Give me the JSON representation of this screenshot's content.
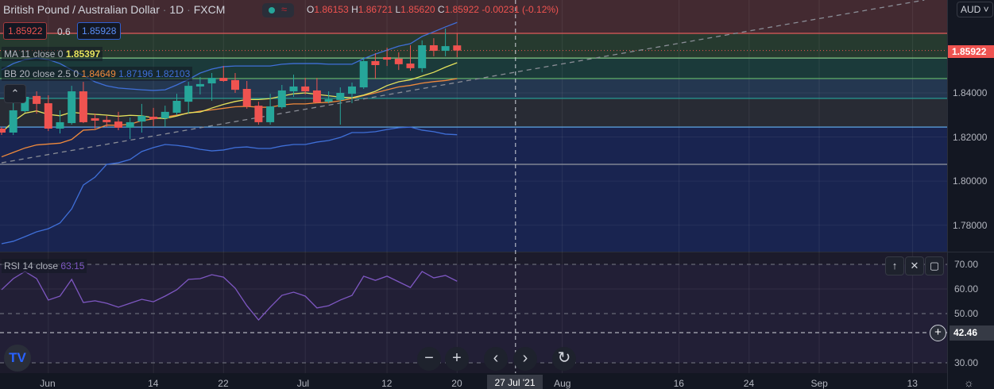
{
  "header": {
    "symbol": "British Pound / Australian Dollar",
    "interval": "1D",
    "source": "FXCM",
    "open_label": "O",
    "open": "1.86153",
    "high_label": "H",
    "high": "1.86721",
    "low_label": "L",
    "low": "1.85620",
    "close_label": "C",
    "close": "1.85922",
    "change": "-0.00231 (-0.12%)",
    "toggle_icon": "≈"
  },
  "trade": {
    "sell": "1.85922",
    "spread": "0.6",
    "buy": "1.85928"
  },
  "indicators": {
    "ma": {
      "label": "MA 11 close 0",
      "value": "1.85397"
    },
    "bb": {
      "label": "BB 20 close 2.5 0",
      "basis": "1.84649",
      "upper": "1.87196",
      "lower": "1.82103"
    },
    "rsi": {
      "label": "RSI 14 close",
      "value": "63.15"
    }
  },
  "currency": "AUD",
  "price_axis": {
    "ticks": [
      "1.84000",
      "1.82000",
      "1.80000",
      "1.78000"
    ],
    "last_price": "1.85922"
  },
  "rsi_axis": {
    "ticks": [
      "70.00",
      "60.00",
      "50.00",
      "30.00"
    ],
    "crosshair_value": "42.46"
  },
  "time_axis": {
    "labels": [
      "Jun",
      "14",
      "22",
      "Jul",
      "12",
      "20",
      "Aug",
      "16",
      "24",
      "Sep",
      "13"
    ],
    "crosshair_label": "27 Jul '21"
  },
  "colors": {
    "up": "#26a69a",
    "down": "#ef5350",
    "ma": "#e6e35c",
    "bb_basis": "#f08a3c",
    "bb_band": "#3f6fd8",
    "rsi": "#7e57c2"
  },
  "chart_data": {
    "type": "candlestick",
    "open": [
      1.8238,
      1.822,
      1.8317,
      1.8386,
      1.8353,
      1.8238,
      1.8263,
      1.8407,
      1.8285,
      1.8278,
      1.827,
      1.8242,
      1.827,
      1.8292,
      1.8285,
      1.831,
      1.836,
      1.8429,
      1.8443,
      1.8468,
      1.8458,
      1.8418,
      1.8342,
      1.8267,
      1.8335,
      1.8407,
      1.8429,
      1.8411,
      1.836,
      1.8368,
      1.8396,
      1.8425,
      1.8544,
      1.8562,
      1.8555,
      1.8533,
      1.8512,
      1.8616,
      1.8591,
      1.86153
    ],
    "high": [
      1.8245,
      1.836,
      1.8407,
      1.8407,
      1.8389,
      1.8321,
      1.8432,
      1.845,
      1.8306,
      1.8296,
      1.8314,
      1.8288,
      1.835,
      1.8332,
      1.8342,
      1.8396,
      1.845,
      1.8472,
      1.849,
      1.8522,
      1.849,
      1.8454,
      1.836,
      1.8396,
      1.8436,
      1.8483,
      1.8468,
      1.8468,
      1.8407,
      1.8425,
      1.8447,
      1.8562,
      1.858,
      1.8605,
      1.8584,
      1.8616,
      1.8638,
      1.8648,
      1.8692,
      1.86721
    ],
    "low": [
      1.8209,
      1.8209,
      1.831,
      1.8306,
      1.8227,
      1.8216,
      1.8256,
      1.8263,
      1.8238,
      1.8245,
      1.8231,
      1.8191,
      1.822,
      1.8249,
      1.8245,
      1.8299,
      1.8306,
      1.8393,
      1.8364,
      1.845,
      1.84,
      1.8328,
      1.8256,
      1.8256,
      1.8328,
      1.8382,
      1.8393,
      1.8353,
      1.8353,
      1.8256,
      1.8353,
      1.8418,
      1.8465,
      1.8522,
      1.8504,
      1.8501,
      1.8494,
      1.8566,
      1.8566,
      1.8562
    ],
    "close": [
      1.822,
      1.8321,
      1.8382,
      1.835,
      1.8238,
      1.8267,
      1.8407,
      1.8267,
      1.8274,
      1.8267,
      1.8242,
      1.8267,
      1.8296,
      1.8281,
      1.8314,
      1.8364,
      1.8432,
      1.844,
      1.8468,
      1.8454,
      1.8414,
      1.8339,
      1.8267,
      1.8339,
      1.8411,
      1.8429,
      1.8407,
      1.8357,
      1.8371,
      1.84,
      1.8429,
      1.8544,
      1.8526,
      1.8551,
      1.853,
      1.8512,
      1.8616,
      1.8591,
      1.8612,
      1.85922
    ],
    "bb_upper": [
      1.8504,
      1.8533,
      1.8551,
      1.8558,
      1.8551,
      1.8533,
      1.8504,
      1.8479,
      1.845,
      1.8432,
      1.8422,
      1.8418,
      1.8414,
      1.8411,
      1.8414,
      1.8436,
      1.8461,
      1.849,
      1.8508,
      1.8519,
      1.8522,
      1.8522,
      1.8522,
      1.8522,
      1.853,
      1.8533,
      1.8533,
      1.8533,
      1.853,
      1.853,
      1.853,
      1.8555,
      1.8576,
      1.8594,
      1.8612,
      1.8623,
      1.8656,
      1.8677,
      1.8699,
      1.87196
    ],
    "bb_basis": [
      1.811,
      1.813,
      1.815,
      1.8164,
      1.8168,
      1.8172,
      1.8189,
      1.8231,
      1.8234,
      1.8254,
      1.8253,
      1.8258,
      1.8274,
      1.8282,
      1.829,
      1.8299,
      1.8308,
      1.8317,
      1.8323,
      1.833,
      1.8337,
      1.8339,
      1.8335,
      1.8335,
      1.8345,
      1.835,
      1.835,
      1.8355,
      1.8357,
      1.8364,
      1.8375,
      1.8388,
      1.84,
      1.8414,
      1.8427,
      1.8434,
      1.8444,
      1.8451,
      1.8456,
      1.84649
    ],
    "bb_lower": [
      1.7716,
      1.7727,
      1.7748,
      1.777,
      1.7784,
      1.781,
      1.7874,
      1.7982,
      1.8018,
      1.8076,
      1.8083,
      1.8098,
      1.8134,
      1.8152,
      1.8166,
      1.8162,
      1.8155,
      1.8144,
      1.8137,
      1.8141,
      1.8152,
      1.8155,
      1.8148,
      1.8148,
      1.8159,
      1.8166,
      1.8166,
      1.8177,
      1.8184,
      1.8198,
      1.822,
      1.822,
      1.8224,
      1.8234,
      1.8242,
      1.8245,
      1.8231,
      1.8224,
      1.8213,
      1.82103
    ],
    "rsi": [
      59.7,
      64.2,
      67.1,
      64.2,
      55.5,
      57.1,
      63.9,
      54.5,
      55.2,
      54.2,
      52.6,
      54.2,
      55.8,
      54.8,
      57.1,
      59.7,
      63.9,
      64.2,
      65.8,
      64.8,
      60.3,
      53.2,
      47.4,
      52.6,
      57.4,
      58.7,
      57.1,
      52.3,
      53.2,
      55.5,
      57.4,
      65.2,
      63.5,
      65.2,
      62.9,
      60.6,
      67.1,
      64.5,
      65.5,
      63.15
    ],
    "fib_levels": [
      1.867,
      1.8558,
      1.8465,
      1.8375,
      1.8245,
      1.8076
    ],
    "fib_colors": [
      "#e05a5a",
      "#81c784",
      "#66bb6a",
      "#26a69a",
      "#64b5f6",
      "#9598a1"
    ],
    "fib_fills": [
      "#432a31",
      "#263a2f",
      "#1b3a3a",
      "#243750",
      "#282b34",
      "#192450"
    ],
    "trendline": [
      {
        "bar": 0,
        "price": 1.8083
      },
      {
        "bar": 79,
        "price": 1.8821
      }
    ],
    "price_range": [
      1.768,
      1.8821
    ],
    "rsi_levels": [
      70,
      50,
      30
    ]
  }
}
